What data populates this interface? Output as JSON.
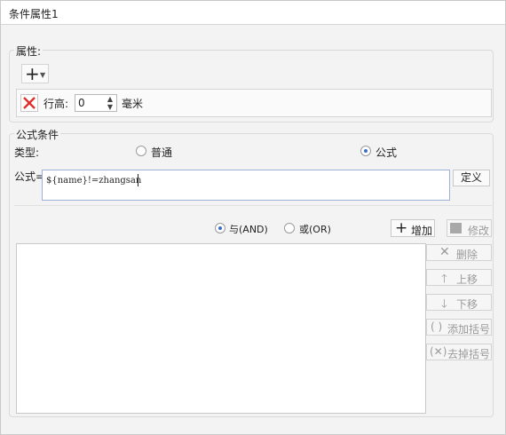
{
  "window": {
    "title": "条件属性1"
  },
  "attributes": {
    "legend": "属性:",
    "add_button_icon": "plus-icon",
    "row_height_label": "行高:",
    "row_height_value": "0",
    "unit_label": "毫米"
  },
  "formula_condition": {
    "legend": "公式条件",
    "type_label": "类型:",
    "type_options": [
      {
        "label": "普通",
        "selected": false
      },
      {
        "label": "公式",
        "selected": true
      }
    ],
    "formula_label": "公式=",
    "formula_value": "${name}!=zhangsan",
    "define_button": "定义",
    "logic_options": [
      {
        "label": "与(AND)",
        "selected": true
      },
      {
        "label": "或(OR)",
        "selected": false
      }
    ],
    "add_button": "增加",
    "modify_button": "修改",
    "side_buttons": {
      "delete": "删除",
      "move_up": "上移",
      "move_down": "下移",
      "add_paren": "添加括号",
      "remove_paren": "去掉括号"
    }
  },
  "colors": {
    "delete_red": "#e0302b",
    "radio_dot": "#3a6fc4",
    "disabled_text": "#9a9a9a"
  }
}
